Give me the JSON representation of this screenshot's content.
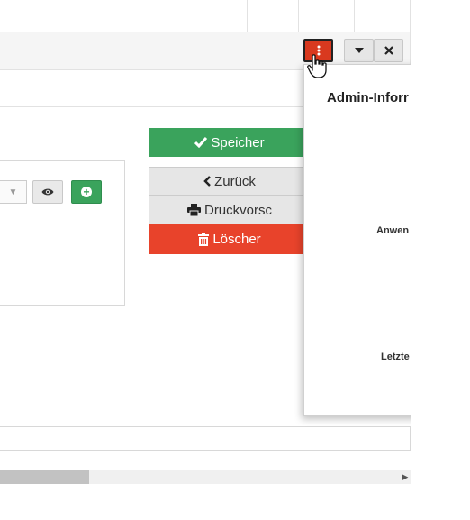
{
  "header": {
    "menu_icon": "ellipsis-vertical-icon",
    "collapse_icon": "caret-down-icon",
    "close_icon": "times-icon",
    "menu_color": "#d9391f"
  },
  "actions": {
    "save_label": "Speicher",
    "back_label": "Zurück",
    "print_label": "Druckvorsc",
    "delete_label": "Löscher",
    "save_color": "#3aa35c",
    "delete_color": "#e8432b"
  },
  "form": {
    "select_icon": "caret-down-icon",
    "view_icon": "eye-icon",
    "add_icon": "plus-circle-icon"
  },
  "admin_panel": {
    "title": "Admin-Inforr",
    "label_1": "Anwen",
    "label_2": "Letzte"
  }
}
